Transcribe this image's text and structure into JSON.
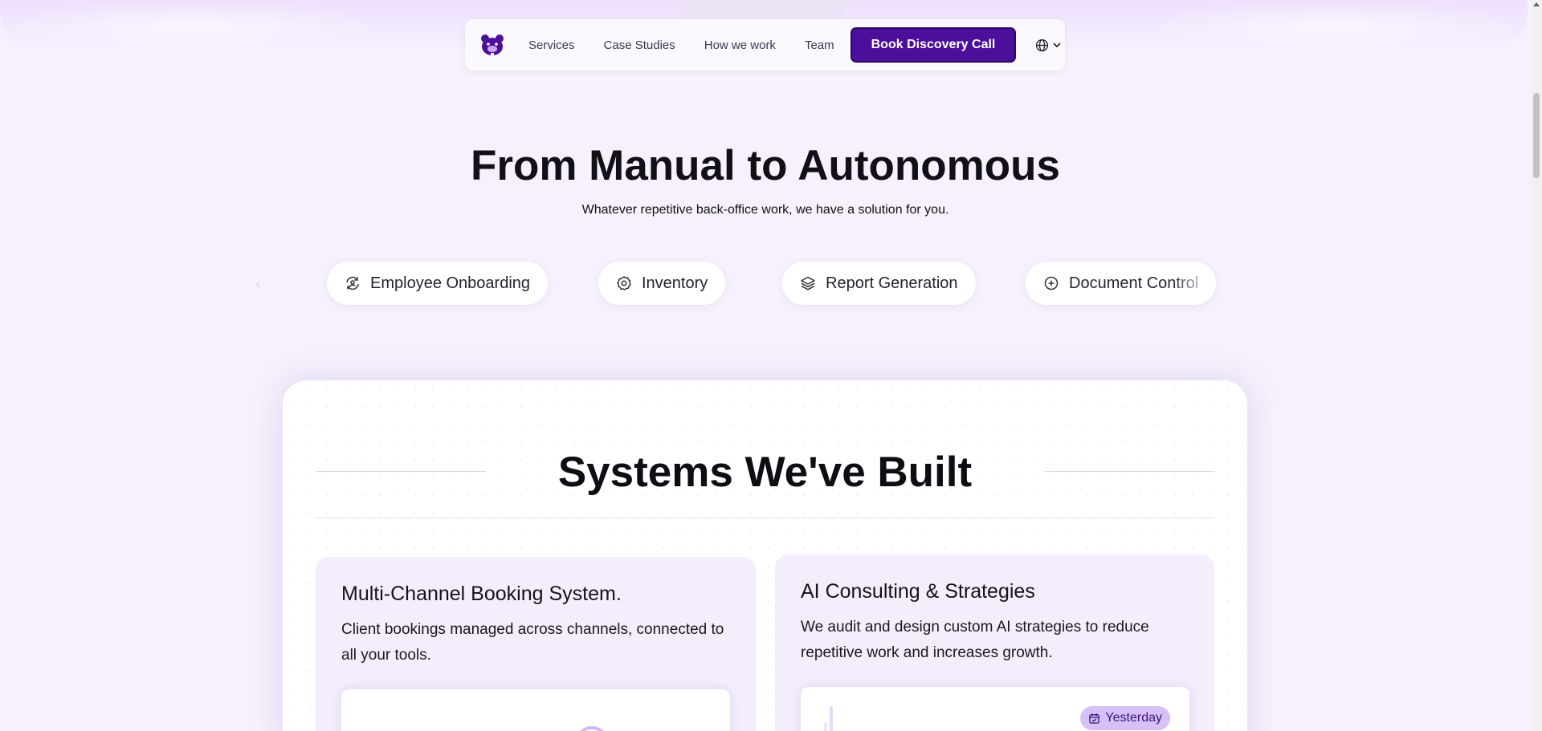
{
  "nav": {
    "links": [
      "Services",
      "Case Studies",
      "How we work",
      "Team"
    ],
    "cta_label": "Book Discovery Call"
  },
  "hero": {
    "title": "From Manual to Autonomous",
    "subtitle": "Whatever repetitive back-office work, we have a solution for you."
  },
  "solutions": [
    {
      "label": "Employee Onboarding",
      "icon": "refresh-user-icon"
    },
    {
      "label": "Inventory",
      "icon": "gear-icon"
    },
    {
      "label": "Report Generation",
      "icon": "layers-icon"
    },
    {
      "label": "Document Control",
      "icon": "plus-circle-icon"
    }
  ],
  "systems": {
    "title": "Systems We've Built",
    "cards": [
      {
        "title": "Multi-Channel Booking System.",
        "description": "Client bookings managed across channels, connected to all your tools."
      },
      {
        "title": "AI Consulting & Strategies",
        "description": "We audit and design custom AI strategies to reduce repetitive work and increases growth.",
        "badge": "Yesterday"
      }
    ]
  },
  "colors": {
    "accent": "#4c0f9b",
    "background": "#f6f1fc",
    "badge": "#d7bff8"
  }
}
